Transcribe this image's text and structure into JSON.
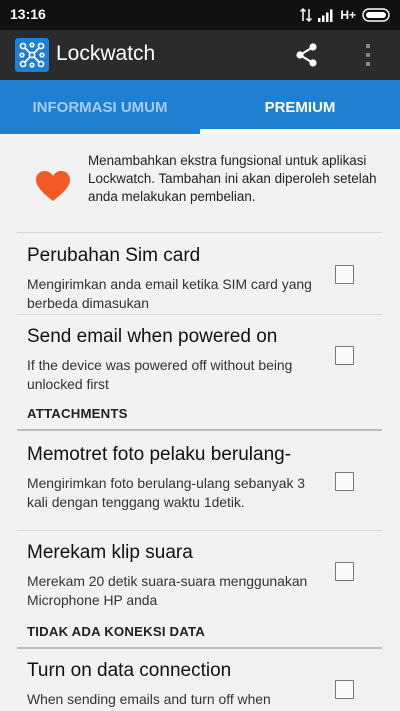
{
  "status": {
    "time": "13:16",
    "network": "H+"
  },
  "appbar": {
    "title": "Lockwatch",
    "icons": {
      "app": "lockwatch-app-icon",
      "share": "share-icon",
      "menu": "overflow-menu-icon"
    }
  },
  "tabs": [
    {
      "label": "INFORMASI UMUM",
      "selected": false
    },
    {
      "label": "PREMIUM",
      "selected": true
    }
  ],
  "intro": {
    "icon": "heart-icon",
    "text": "Menambahkan ekstra fungsional untuk aplikasi Lockwatch. Tambahan ini akan diperoleh setelah anda melakukan pembelian."
  },
  "preferences": [
    {
      "title": "Perubahan Sim card",
      "summary": "Mengirimkan anda email ketika SIM card yang berbeda dimasukan",
      "checked": false
    },
    {
      "title": "Send email when powered on",
      "summary": "If the device was powered off without being unlocked first",
      "checked": false
    }
  ],
  "sections": [
    {
      "header": "ATTACHMENTS",
      "items": [
        {
          "title": "Memotret foto pelaku berulang-",
          "summary": "Mengirimkan foto berulang-ulang sebanyak 3 kali dengan tenggang waktu 1detik.",
          "checked": false
        },
        {
          "title": "Merekam klip suara",
          "summary": "Merekam 20 detik suara-suara menggunakan Microphone HP anda",
          "checked": false
        }
      ]
    },
    {
      "header": "TIDAK ADA KONEKSI DATA",
      "items": [
        {
          "title": "Turn on data connection",
          "summary": "When sending emails and turn off when",
          "checked": false
        }
      ]
    }
  ],
  "colors": {
    "accent": "#1e7fd3",
    "appbar": "#2b2b2b",
    "statusbar": "#111111",
    "heart": "#f15a24",
    "background": "#f2f2f2"
  }
}
